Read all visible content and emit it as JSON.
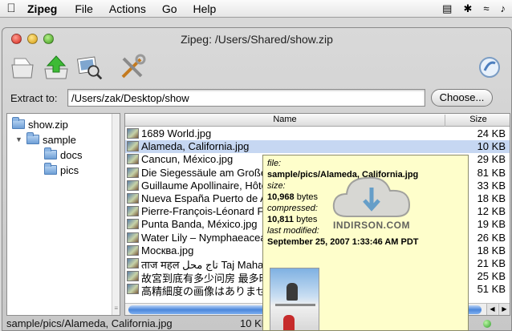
{
  "menubar": {
    "app_name": "Zipeg",
    "items": [
      "File",
      "Actions",
      "Go",
      "Help"
    ]
  },
  "window": {
    "title": "Zipeg: /Users/Shared/show.zip"
  },
  "toolbar": {
    "icons": [
      "open-archive-icon",
      "extract-icon",
      "preview-icon",
      "options-icon",
      "help-icon"
    ]
  },
  "extract": {
    "label": "Extract to:",
    "value": "/Users/zak/Desktop/show",
    "choose_label": "Choose..."
  },
  "tree": {
    "items": [
      {
        "label": "show.zip"
      },
      {
        "label": "sample"
      },
      {
        "label": "docs"
      },
      {
        "label": "pics"
      }
    ]
  },
  "list": {
    "columns": {
      "name": "Name",
      "size": "Size"
    },
    "rows": [
      {
        "name": "1689 World.jpg",
        "size": "24 KB"
      },
      {
        "name": "Alameda, California.jpg",
        "size": "10 KB"
      },
      {
        "name": "Cancun, México.jpg",
        "size": "29 KB"
      },
      {
        "name": "Die Siegessäule am Großer",
        "size": "81 KB"
      },
      {
        "name": "Guillaume Apollinaire, Hôte",
        "size": "33 KB"
      },
      {
        "name": "Nueva España Puerto de A",
        "size": "18 KB"
      },
      {
        "name": "Pierre-François-Léonard Fo",
        "size": "12 KB"
      },
      {
        "name": "Punta Banda, México.jpg",
        "size": "19 KB"
      },
      {
        "name": "Water Lily – Nymphaeacea",
        "size": "26 KB"
      },
      {
        "name": "Москва.jpg",
        "size": "18 KB"
      },
      {
        "name": "ताज महल تاج محل Taj Mahal.j",
        "size": "21 KB"
      },
      {
        "name": "故宮到底有多少问房 最多时",
        "size": "25 KB"
      },
      {
        "name": "高精細度の画像はありませ",
        "size": "51 KB"
      }
    ]
  },
  "tooltip": {
    "file_label": "file:",
    "file_value": "sample/pics/Alameda, California.jpg",
    "size_label": "size:",
    "size_value": "10,968",
    "size_unit": "bytes",
    "compressed_label": "compressed:",
    "compressed_value": "10,811",
    "compressed_unit": "bytes",
    "modified_label": "last modified:",
    "modified_value": "September 25, 2007 1:33:46 AM PDT"
  },
  "watermark": {
    "text": "INDIRSON.COM"
  },
  "status": {
    "path": "sample/pics/Alameda, California.jpg",
    "size": "10 KB"
  },
  "colors": {
    "selection": "#c6d7f2",
    "tooltip_bg": "#fefecb",
    "scroll_thumb": "#4b86db"
  }
}
